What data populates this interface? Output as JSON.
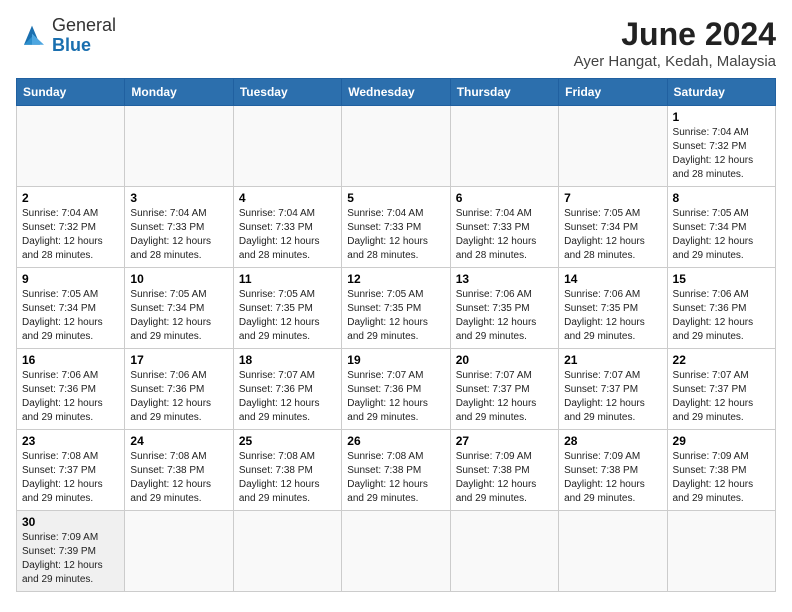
{
  "header": {
    "logo_general": "General",
    "logo_blue": "Blue",
    "title": "June 2024",
    "subtitle": "Ayer Hangat, Kedah, Malaysia"
  },
  "weekdays": [
    "Sunday",
    "Monday",
    "Tuesday",
    "Wednesday",
    "Thursday",
    "Friday",
    "Saturday"
  ],
  "weeks": [
    [
      {
        "day": "",
        "info": ""
      },
      {
        "day": "",
        "info": ""
      },
      {
        "day": "",
        "info": ""
      },
      {
        "day": "",
        "info": ""
      },
      {
        "day": "",
        "info": ""
      },
      {
        "day": "",
        "info": ""
      },
      {
        "day": "1",
        "info": "Sunrise: 7:04 AM\nSunset: 7:32 PM\nDaylight: 12 hours\nand 28 minutes."
      }
    ],
    [
      {
        "day": "2",
        "info": "Sunrise: 7:04 AM\nSunset: 7:32 PM\nDaylight: 12 hours\nand 28 minutes."
      },
      {
        "day": "3",
        "info": "Sunrise: 7:04 AM\nSunset: 7:33 PM\nDaylight: 12 hours\nand 28 minutes."
      },
      {
        "day": "4",
        "info": "Sunrise: 7:04 AM\nSunset: 7:33 PM\nDaylight: 12 hours\nand 28 minutes."
      },
      {
        "day": "5",
        "info": "Sunrise: 7:04 AM\nSunset: 7:33 PM\nDaylight: 12 hours\nand 28 minutes."
      },
      {
        "day": "6",
        "info": "Sunrise: 7:04 AM\nSunset: 7:33 PM\nDaylight: 12 hours\nand 28 minutes."
      },
      {
        "day": "7",
        "info": "Sunrise: 7:05 AM\nSunset: 7:34 PM\nDaylight: 12 hours\nand 28 minutes."
      },
      {
        "day": "8",
        "info": "Sunrise: 7:05 AM\nSunset: 7:34 PM\nDaylight: 12 hours\nand 29 minutes."
      }
    ],
    [
      {
        "day": "9",
        "info": "Sunrise: 7:05 AM\nSunset: 7:34 PM\nDaylight: 12 hours\nand 29 minutes."
      },
      {
        "day": "10",
        "info": "Sunrise: 7:05 AM\nSunset: 7:34 PM\nDaylight: 12 hours\nand 29 minutes."
      },
      {
        "day": "11",
        "info": "Sunrise: 7:05 AM\nSunset: 7:35 PM\nDaylight: 12 hours\nand 29 minutes."
      },
      {
        "day": "12",
        "info": "Sunrise: 7:05 AM\nSunset: 7:35 PM\nDaylight: 12 hours\nand 29 minutes."
      },
      {
        "day": "13",
        "info": "Sunrise: 7:06 AM\nSunset: 7:35 PM\nDaylight: 12 hours\nand 29 minutes."
      },
      {
        "day": "14",
        "info": "Sunrise: 7:06 AM\nSunset: 7:35 PM\nDaylight: 12 hours\nand 29 minutes."
      },
      {
        "day": "15",
        "info": "Sunrise: 7:06 AM\nSunset: 7:36 PM\nDaylight: 12 hours\nand 29 minutes."
      }
    ],
    [
      {
        "day": "16",
        "info": "Sunrise: 7:06 AM\nSunset: 7:36 PM\nDaylight: 12 hours\nand 29 minutes."
      },
      {
        "day": "17",
        "info": "Sunrise: 7:06 AM\nSunset: 7:36 PM\nDaylight: 12 hours\nand 29 minutes."
      },
      {
        "day": "18",
        "info": "Sunrise: 7:07 AM\nSunset: 7:36 PM\nDaylight: 12 hours\nand 29 minutes."
      },
      {
        "day": "19",
        "info": "Sunrise: 7:07 AM\nSunset: 7:36 PM\nDaylight: 12 hours\nand 29 minutes."
      },
      {
        "day": "20",
        "info": "Sunrise: 7:07 AM\nSunset: 7:37 PM\nDaylight: 12 hours\nand 29 minutes."
      },
      {
        "day": "21",
        "info": "Sunrise: 7:07 AM\nSunset: 7:37 PM\nDaylight: 12 hours\nand 29 minutes."
      },
      {
        "day": "22",
        "info": "Sunrise: 7:07 AM\nSunset: 7:37 PM\nDaylight: 12 hours\nand 29 minutes."
      }
    ],
    [
      {
        "day": "23",
        "info": "Sunrise: 7:08 AM\nSunset: 7:37 PM\nDaylight: 12 hours\nand 29 minutes."
      },
      {
        "day": "24",
        "info": "Sunrise: 7:08 AM\nSunset: 7:38 PM\nDaylight: 12 hours\nand 29 minutes."
      },
      {
        "day": "25",
        "info": "Sunrise: 7:08 AM\nSunset: 7:38 PM\nDaylight: 12 hours\nand 29 minutes."
      },
      {
        "day": "26",
        "info": "Sunrise: 7:08 AM\nSunset: 7:38 PM\nDaylight: 12 hours\nand 29 minutes."
      },
      {
        "day": "27",
        "info": "Sunrise: 7:09 AM\nSunset: 7:38 PM\nDaylight: 12 hours\nand 29 minutes."
      },
      {
        "day": "28",
        "info": "Sunrise: 7:09 AM\nSunset: 7:38 PM\nDaylight: 12 hours\nand 29 minutes."
      },
      {
        "day": "29",
        "info": "Sunrise: 7:09 AM\nSunset: 7:38 PM\nDaylight: 12 hours\nand 29 minutes."
      }
    ],
    [
      {
        "day": "30",
        "info": "Sunrise: 7:09 AM\nSunset: 7:39 PM\nDaylight: 12 hours\nand 29 minutes."
      },
      {
        "day": "",
        "info": ""
      },
      {
        "day": "",
        "info": ""
      },
      {
        "day": "",
        "info": ""
      },
      {
        "day": "",
        "info": ""
      },
      {
        "day": "",
        "info": ""
      },
      {
        "day": "",
        "info": ""
      }
    ]
  ]
}
